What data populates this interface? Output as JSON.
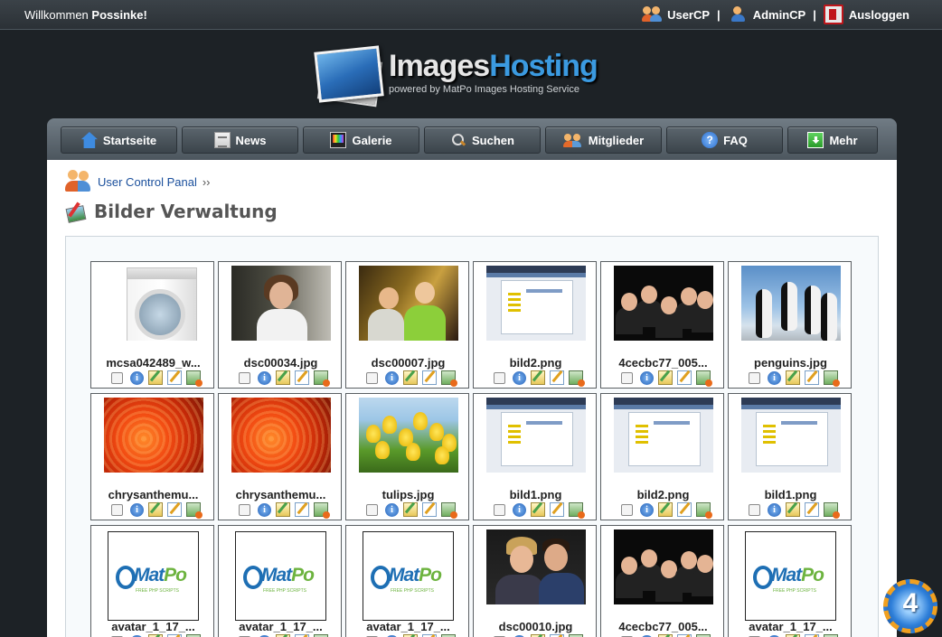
{
  "topbar": {
    "welcome_prefix": "Willkommen",
    "username": "Possinke!",
    "links": {
      "usercp": "UserCP",
      "admincp": "AdminCP",
      "logout": "Ausloggen"
    },
    "separator": "|"
  },
  "logo": {
    "title_part1": "Images",
    "title_part2": "Hosting",
    "subtitle": "powered by MatPo Images Hosting Service"
  },
  "nav": [
    {
      "label": "Startseite",
      "icon": "home-icon"
    },
    {
      "label": "News",
      "icon": "news-icon"
    },
    {
      "label": "Galerie",
      "icon": "gallery-icon"
    },
    {
      "label": "Suchen",
      "icon": "search-icon"
    },
    {
      "label": "Mitglieder",
      "icon": "members-icon"
    },
    {
      "label": "FAQ",
      "icon": "faq-icon"
    },
    {
      "label": "Mehr",
      "icon": "more-icon"
    }
  ],
  "breadcrumb": {
    "label": "User Control Panal",
    "suffix": "››"
  },
  "page_title": "Bilder Verwaltung",
  "info_icon_glyph": "i",
  "faq_icon_glyph": "?",
  "gallery": [
    {
      "name": "mcsa042489_w...",
      "art": "washer"
    },
    {
      "name": "dsc00034.jpg",
      "art": "woman"
    },
    {
      "name": "dsc00007.jpg",
      "art": "party"
    },
    {
      "name": "bild2.png",
      "art": "shot"
    },
    {
      "name": "4cecbc77_005...",
      "art": "group"
    },
    {
      "name": "penguins.jpg",
      "art": "penguin"
    },
    {
      "name": "chrysanthemu...",
      "art": "flower"
    },
    {
      "name": "chrysanthemu...",
      "art": "flower"
    },
    {
      "name": "tulips.jpg",
      "art": "tulip"
    },
    {
      "name": "bild1.png",
      "art": "shot"
    },
    {
      "name": "bild2.png",
      "art": "shot"
    },
    {
      "name": "bild1.png",
      "art": "shot"
    },
    {
      "name": "avatar_1_17_...",
      "art": "avatar"
    },
    {
      "name": "avatar_1_17_...",
      "art": "avatar"
    },
    {
      "name": "avatar_1_17_...",
      "art": "avatar"
    },
    {
      "name": "dsc00010.jpg",
      "art": "couple"
    },
    {
      "name": "4cecbc77_005...",
      "art": "group"
    },
    {
      "name": "avatar_1_17_...",
      "art": "avatar"
    }
  ],
  "avatar_logo": {
    "part1": "Mat",
    "part2": "Po",
    "tagline": "FREE PHP SCRIPTS"
  },
  "badge_number": "4",
  "colors": {
    "accent_blue": "#3b9ae0",
    "link_blue": "#1a4f9c",
    "nav_dark": "#3b444b",
    "page_bg": "#1d2226"
  }
}
